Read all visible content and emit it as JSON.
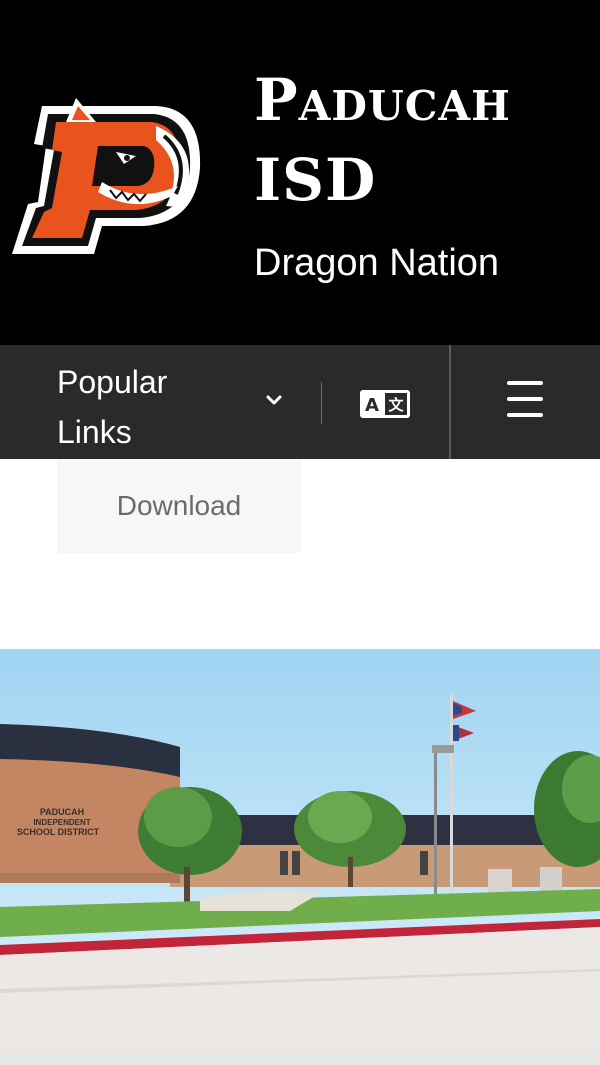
{
  "header": {
    "title": "Paducah ISD",
    "tagline": "Dragon Nation",
    "logo_icon": "dragon-p-logo",
    "background": "#000000"
  },
  "navbar": {
    "popular_links_label": "Popular Links",
    "dropdown_icon": "chevron-down-icon",
    "translate_icon": "translate-icon",
    "menu_icon": "hamburger-menu-icon",
    "background": "#2a2a2a"
  },
  "content": {
    "download_label": "Download"
  },
  "hero": {
    "image": "school-building-photo",
    "building_sign": [
      "PADUCAH",
      "INDEPENDENT",
      "SCHOOL DISTRICT"
    ]
  },
  "colors": {
    "accent": "#e8531e",
    "text_light": "#ffffff",
    "button_bg": "#f7f7f7",
    "button_text": "#6b6b6b"
  }
}
